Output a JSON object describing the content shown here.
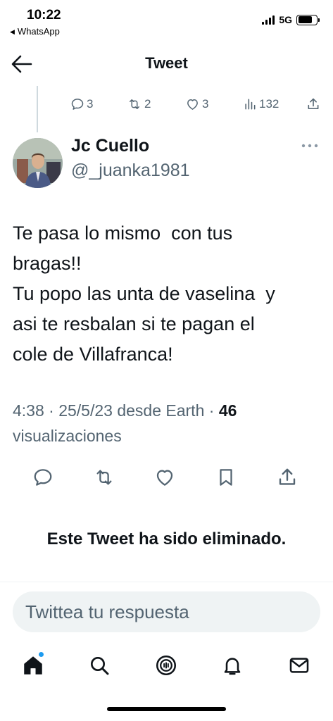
{
  "status_bar": {
    "time": "10:22",
    "back_app": "WhatsApp",
    "network": "5G",
    "battery_level": 0.78
  },
  "header": {
    "title": "Tweet"
  },
  "parent_tweet_stats": {
    "replies": "3",
    "retweets": "2",
    "likes": "3",
    "views": "132"
  },
  "tweet": {
    "author_name": "Jc Cuello",
    "author_handle": "@_juanka1981",
    "text_lines": [
      "Te pasa lo mismo  con tus",
      "bragas!!",
      "Tu popo las unta de vaselina  y",
      "asi te resbalan si te pagan el",
      "cole de Villafranca!"
    ],
    "meta_time": "4:38 · 25/5/23 desde Earth · ",
    "view_count": "46",
    "view_label": "visualizaciones"
  },
  "deleted_notice": "Este Tweet ha sido eliminado.",
  "reply": {
    "placeholder": "Twittea tu respuesta"
  },
  "icons": {
    "back": "arrow-left-icon",
    "reply": "reply-icon",
    "retweet": "retweet-icon",
    "like": "heart-icon",
    "views": "views-icon",
    "share": "share-icon",
    "bookmark": "bookmark-icon",
    "more": "more-icon",
    "home": "home-icon",
    "search": "search-icon",
    "spaces": "spaces-icon",
    "notifications": "bell-icon",
    "messages": "mail-icon"
  },
  "colors": {
    "text": "#0f1419",
    "secondary": "#536471",
    "accent": "#1d9bf0",
    "input_bg": "#eff3f4"
  }
}
